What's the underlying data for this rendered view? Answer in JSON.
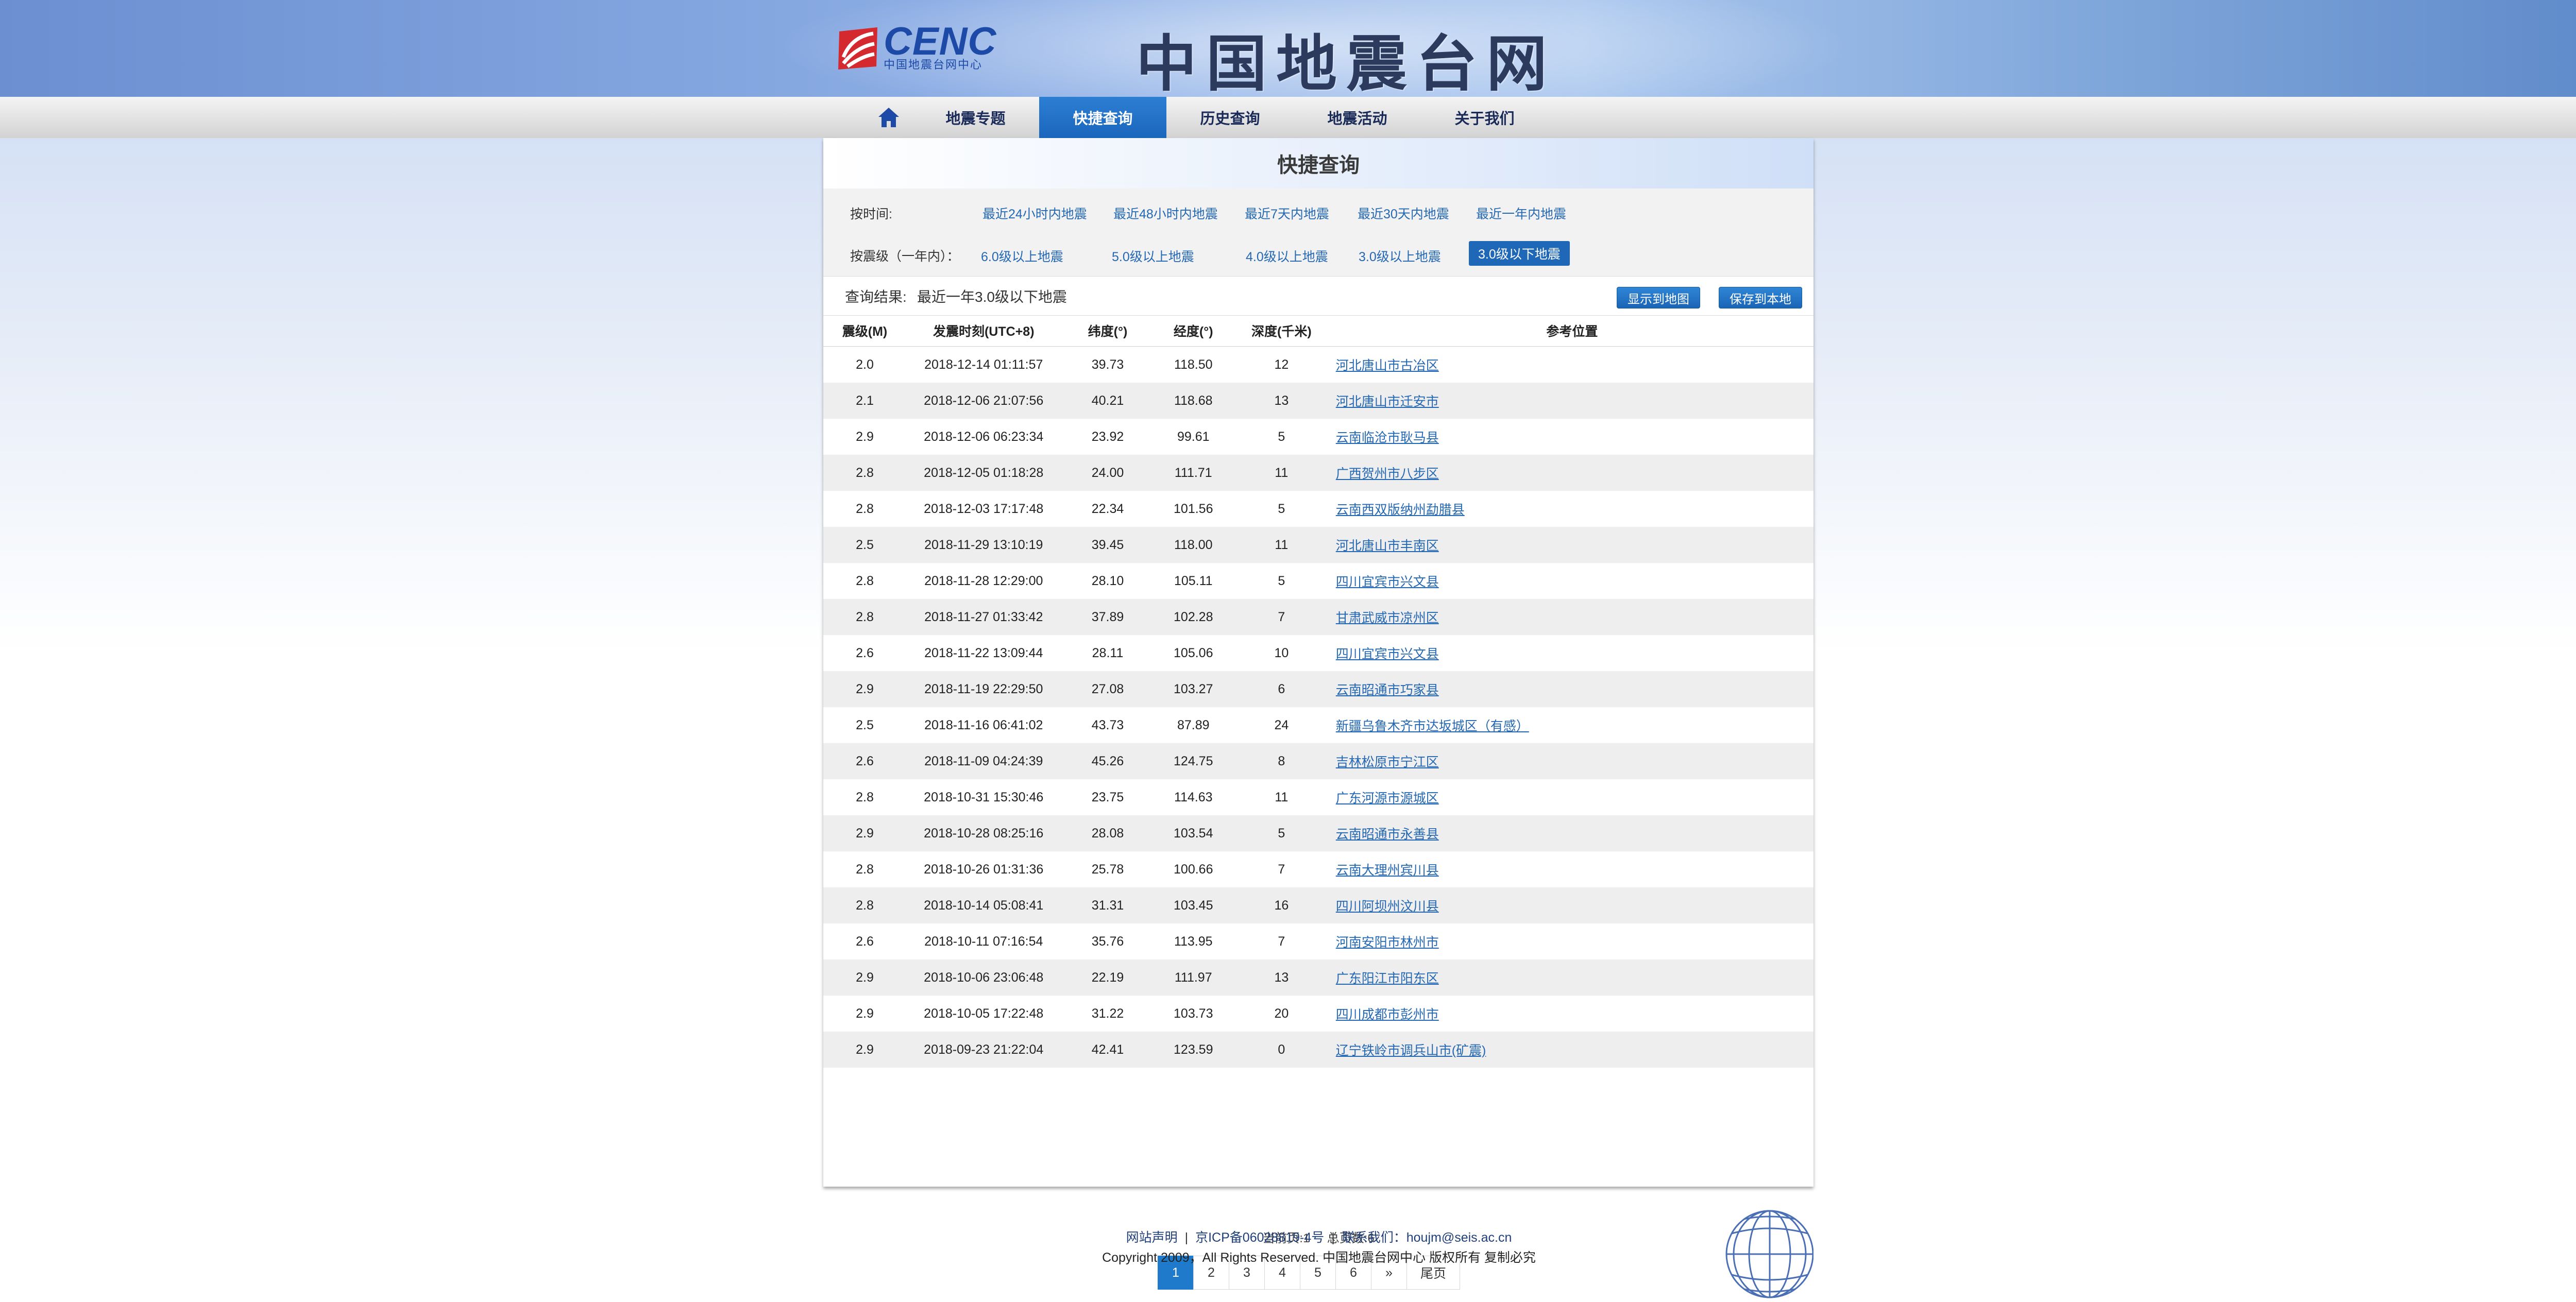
{
  "header": {
    "logo_text": "CENC",
    "logo_subtext": "中国地震台网中心",
    "site_title": "中国地震台网"
  },
  "nav": {
    "home_icon": "home-icon",
    "items": [
      {
        "label": "地震专题",
        "active": false
      },
      {
        "label": "快捷查询",
        "active": true
      },
      {
        "label": "历史查询",
        "active": false
      },
      {
        "label": "地震活动",
        "active": false
      },
      {
        "label": "关于我们",
        "active": false
      }
    ]
  },
  "panel": {
    "title": "快捷查询",
    "by_time_label": "按时间:",
    "time_links": [
      "最近24小时内地震",
      "最近48小时内地震",
      "最近7天内地震",
      "最近30天内地震",
      "最近一年内地震"
    ],
    "by_mag_label": "按震级（一年内）：",
    "mag_links": [
      "6.0级以上地震",
      "5.0级以上地震",
      "4.0级以上地震",
      "3.0级以上地震",
      "3.0级以下地震"
    ],
    "mag_selected": "3.0级以下地震"
  },
  "result": {
    "label": "查询结果:",
    "value": "最近一年3.0级以下地震",
    "show_map_button": "显示到地图",
    "save_button": "保存到本地"
  },
  "table": {
    "headers": [
      "震级(M)",
      "发震时刻(UTC+8)",
      "纬度(°)",
      "经度(°)",
      "深度(千米)",
      "参考位置"
    ],
    "rows": [
      [
        "2.0",
        "2018-12-14 01:11:57",
        "39.73",
        "118.50",
        "12",
        "河北唐山市古冶区"
      ],
      [
        "2.1",
        "2018-12-06 21:07:56",
        "40.21",
        "118.68",
        "13",
        "河北唐山市迁安市"
      ],
      [
        "2.9",
        "2018-12-06 06:23:34",
        "23.92",
        "99.61",
        "5",
        "云南临沧市耿马县"
      ],
      [
        "2.8",
        "2018-12-05 01:18:28",
        "24.00",
        "111.71",
        "11",
        "广西贺州市八步区"
      ],
      [
        "2.8",
        "2018-12-03 17:17:48",
        "22.34",
        "101.56",
        "5",
        "云南西双版纳州勐腊县"
      ],
      [
        "2.5",
        "2018-11-29 13:10:19",
        "39.45",
        "118.00",
        "11",
        "河北唐山市丰南区"
      ],
      [
        "2.8",
        "2018-11-28 12:29:00",
        "28.10",
        "105.11",
        "5",
        "四川宜宾市兴文县"
      ],
      [
        "2.8",
        "2018-11-27 01:33:42",
        "37.89",
        "102.28",
        "7",
        "甘肃武威市凉州区"
      ],
      [
        "2.6",
        "2018-11-22 13:09:44",
        "28.11",
        "105.06",
        "10",
        "四川宜宾市兴文县"
      ],
      [
        "2.9",
        "2018-11-19 22:29:50",
        "27.08",
        "103.27",
        "6",
        "云南昭通市巧家县"
      ],
      [
        "2.5",
        "2018-11-16 06:41:02",
        "43.73",
        "87.89",
        "24",
        "新疆乌鲁木齐市达坂城区（有感）"
      ],
      [
        "2.6",
        "2018-11-09 04:24:39",
        "45.26",
        "124.75",
        "8",
        "吉林松原市宁江区"
      ],
      [
        "2.8",
        "2018-10-31 15:30:46",
        "23.75",
        "114.63",
        "11",
        "广东河源市源城区"
      ],
      [
        "2.9",
        "2018-10-28 08:25:16",
        "28.08",
        "103.54",
        "5",
        "云南昭通市永善县"
      ],
      [
        "2.8",
        "2018-10-26 01:31:36",
        "25.78",
        "100.66",
        "7",
        "云南大理州宾川县"
      ],
      [
        "2.8",
        "2018-10-14 05:08:41",
        "31.31",
        "103.45",
        "16",
        "四川阿坝州汶川县"
      ],
      [
        "2.6",
        "2018-10-11 07:16:54",
        "35.76",
        "113.95",
        "7",
        "河南安阳市林州市"
      ],
      [
        "2.9",
        "2018-10-06 23:06:48",
        "22.19",
        "111.97",
        "13",
        "广东阳江市阳东区"
      ],
      [
        "2.9",
        "2018-10-05 17:22:48",
        "31.22",
        "103.73",
        "20",
        "四川成都市彭州市"
      ],
      [
        "2.9",
        "2018-09-23 21:22:04",
        "42.41",
        "123.59",
        "0",
        "辽宁铁岭市调兵山市(矿震)"
      ]
    ]
  },
  "pagination": {
    "current_label": "当前页:1",
    "total_label": "总页数:6",
    "pages": [
      "1",
      "2",
      "3",
      "4",
      "5",
      "6"
    ],
    "next": "»",
    "last": "尾页"
  },
  "footer": {
    "link1": "网站声明",
    "link2": "京ICP备06028819-4号",
    "contact": "联系我们：houjm@seis.ac.cn",
    "copyright": "Copyright 2009，All Rights Reserved. 中国地震台网中心 版权所有 复制必究"
  },
  "colors": {
    "accent": "#1f68b8",
    "link": "#2468b3",
    "logo_red": "#d42a2f"
  }
}
